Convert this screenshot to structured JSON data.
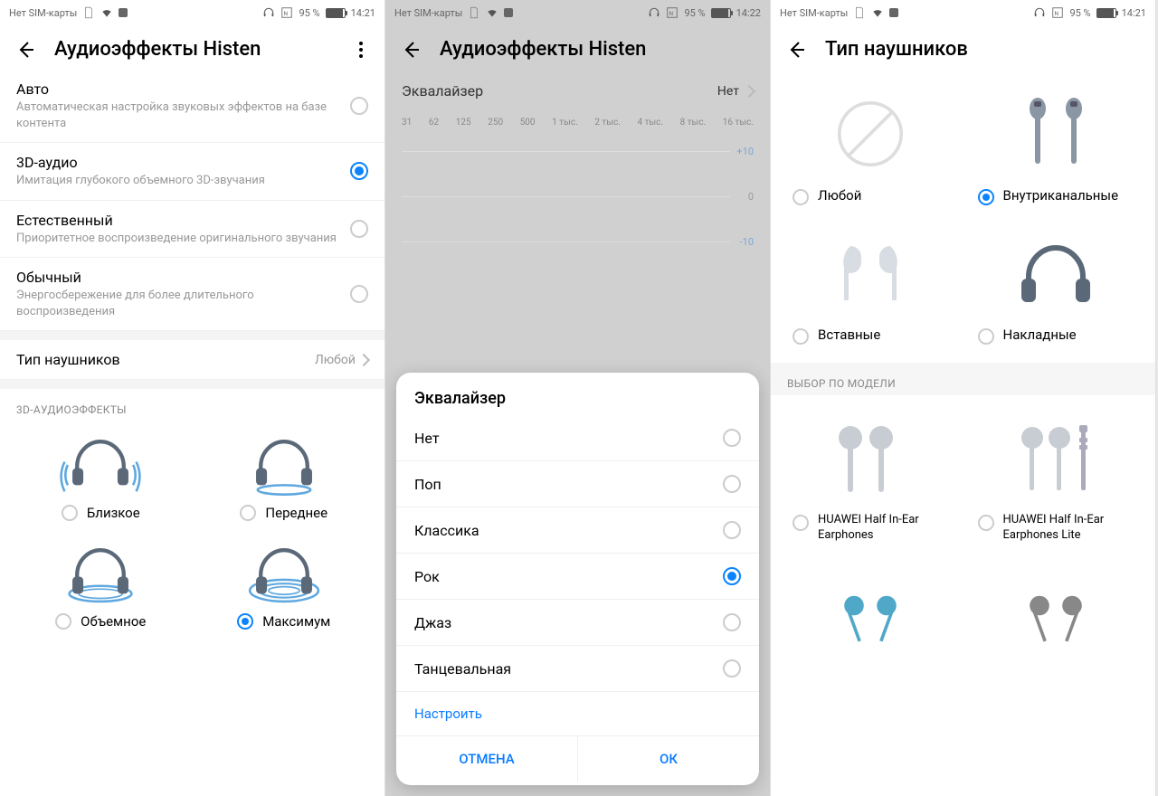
{
  "status": {
    "sim": "Нет SIM-карты",
    "battery": "95 %",
    "t1": "14:21",
    "t2": "14:22",
    "t3": "14:21"
  },
  "s1": {
    "title": "Аудиоэффекты Histen",
    "modes": [
      {
        "t": "Авто",
        "d": "Автоматическая настройка звуковых эффектов на базе контента",
        "sel": false
      },
      {
        "t": "3D-аудио",
        "d": "Имитация глубокого объемного 3D-звучания",
        "sel": true
      },
      {
        "t": "Естественный",
        "d": "Приоритетное воспроизведение оригинального звучания",
        "sel": false
      },
      {
        "t": "Обычный",
        "d": "Энергосбережение для более длительного воспроизведения",
        "sel": false
      }
    ],
    "hp_row": {
      "label": "Тип наушников",
      "value": "Любой"
    },
    "fx_header": "3D-АУДИОЭФФЕКТЫ",
    "fx": [
      {
        "l": "Близкое",
        "sel": false
      },
      {
        "l": "Переднее",
        "sel": false
      },
      {
        "l": "Объемное",
        "sel": false
      },
      {
        "l": "Максимум",
        "sel": true
      }
    ]
  },
  "s2": {
    "title": "Аудиоэффекты Histen",
    "eq_label": "Эквалайзер",
    "eq_value": "Нет",
    "freqs": [
      "31",
      "62",
      "125",
      "250",
      "500",
      "1 тыс.",
      "2 тыс.",
      "4 тыс.",
      "8 тыс.",
      "16 тыс."
    ],
    "scale": [
      "+10",
      "0",
      "-10"
    ],
    "dlg": {
      "title": "Эквалайзер",
      "opts": [
        {
          "l": "Нет",
          "sel": false
        },
        {
          "l": "Поп",
          "sel": false
        },
        {
          "l": "Классика",
          "sel": false
        },
        {
          "l": "Рок",
          "sel": true
        },
        {
          "l": "Джаз",
          "sel": false
        },
        {
          "l": "Танцевальная",
          "sel": false
        }
      ],
      "custom": "Настроить",
      "cancel": "ОТМЕНА",
      "ok": "ОК"
    }
  },
  "s3": {
    "title": "Тип наушников",
    "types": [
      {
        "l": "Любой",
        "sel": false,
        "icon": "none"
      },
      {
        "l": "Внутриканальные",
        "sel": true,
        "icon": "inear"
      },
      {
        "l": "Вставные",
        "sel": false,
        "icon": "earbud"
      },
      {
        "l": "Накладные",
        "sel": false,
        "icon": "overear"
      }
    ],
    "model_header": "ВЫБОР ПО МОДЕЛИ",
    "models": [
      {
        "l": "HUAWEI Half In-Ear Earphones",
        "sel": false
      },
      {
        "l": "HUAWEI Half In-Ear Earphones Lite",
        "sel": false
      }
    ]
  }
}
